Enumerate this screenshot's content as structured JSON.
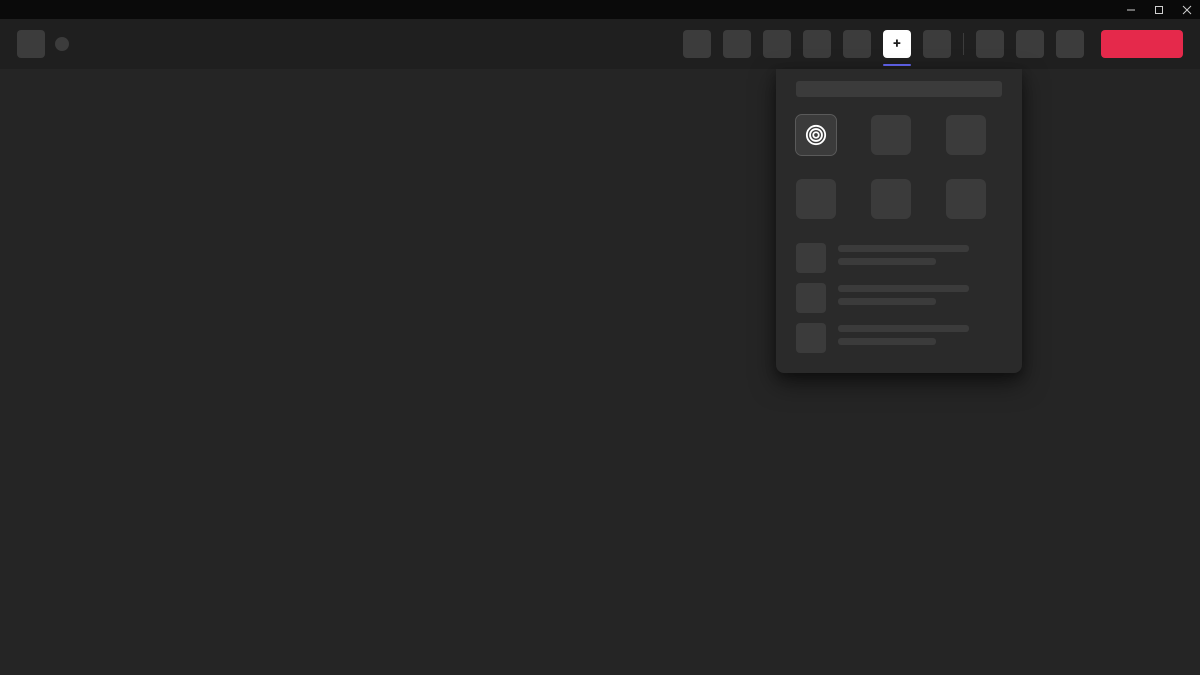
{
  "window": {
    "minimize_label": "Minimize",
    "maximize_label": "Maximize",
    "close_label": "Close"
  },
  "header": {
    "logo_label": "App Logo",
    "status_label": "Status",
    "nav": [
      {
        "id": "nav-1",
        "label": ""
      },
      {
        "id": "nav-2",
        "label": ""
      },
      {
        "id": "nav-3",
        "label": ""
      },
      {
        "id": "nav-4",
        "label": ""
      },
      {
        "id": "nav-5",
        "label": ""
      },
      {
        "id": "nav-add",
        "label": "+",
        "active": true
      },
      {
        "id": "nav-7",
        "label": ""
      }
    ],
    "nav_secondary": [
      {
        "id": "nav-s1",
        "label": ""
      },
      {
        "id": "nav-s2",
        "label": ""
      },
      {
        "id": "nav-s3",
        "label": ""
      }
    ],
    "cta_label": ""
  },
  "panel": {
    "search_placeholder": "",
    "tiles": [
      {
        "id": "tile-1",
        "label": "",
        "selected": true,
        "icon": "spiral-icon"
      },
      {
        "id": "tile-2",
        "label": ""
      },
      {
        "id": "tile-3",
        "label": ""
      },
      {
        "id": "tile-4",
        "label": ""
      },
      {
        "id": "tile-5",
        "label": ""
      },
      {
        "id": "tile-6",
        "label": ""
      }
    ],
    "items": [
      {
        "id": "item-1",
        "title": "",
        "subtitle": ""
      },
      {
        "id": "item-2",
        "title": "",
        "subtitle": ""
      },
      {
        "id": "item-3",
        "title": "",
        "subtitle": ""
      }
    ]
  },
  "colors": {
    "accent": "#e5294b",
    "active_indicator": "#6366f1",
    "surface0": "#0a0a0a",
    "surface1": "#1f1f1f",
    "surface2": "#252525",
    "surface3": "#2a2a2a",
    "fill": "#3b3b3b"
  }
}
